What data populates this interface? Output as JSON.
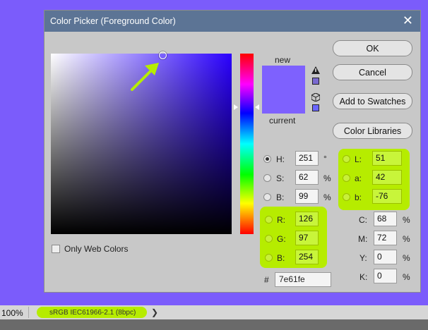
{
  "window": {
    "title": "Color Picker (Foreground Color)",
    "close_glyph": "✕"
  },
  "labels": {
    "new": "new",
    "current": "current",
    "only_web_colors": "Only Web Colors",
    "hex_hash": "#"
  },
  "swatches": {
    "new_color": "#7e61fe",
    "current_color": "#7e61fe"
  },
  "buttons": {
    "ok": "OK",
    "cancel": "Cancel",
    "add_to_swatches": "Add to Swatches",
    "color_libraries": "Color Libraries"
  },
  "hsb": {
    "h": {
      "label": "H:",
      "value": "251",
      "unit": "°"
    },
    "s": {
      "label": "S:",
      "value": "62",
      "unit": "%"
    },
    "b": {
      "label": "B:",
      "value": "99",
      "unit": "%"
    }
  },
  "rgb": {
    "r": {
      "label": "R:",
      "value": "126"
    },
    "g": {
      "label": "G:",
      "value": "97"
    },
    "b": {
      "label": "B:",
      "value": "254"
    }
  },
  "lab": {
    "l": {
      "label": "L:",
      "value": "51"
    },
    "a": {
      "label": "a:",
      "value": "42"
    },
    "b": {
      "label": "b:",
      "value": "-76"
    }
  },
  "cmyk": {
    "c": {
      "label": "C:",
      "value": "68",
      "unit": "%"
    },
    "m": {
      "label": "M:",
      "value": "72",
      "unit": "%"
    },
    "y": {
      "label": "Y:",
      "value": "0",
      "unit": "%"
    },
    "k": {
      "label": "K:",
      "value": "0",
      "unit": "%"
    }
  },
  "hex": "7e61fe",
  "status": {
    "zoom": "100%",
    "profile": "sRGB IEC61966-2.1 (8bpc)",
    "chevron": "❯"
  },
  "colors": {
    "highlight": "#b6ec00",
    "background": "#7b5cfb",
    "titlebar": "#5c7495"
  }
}
